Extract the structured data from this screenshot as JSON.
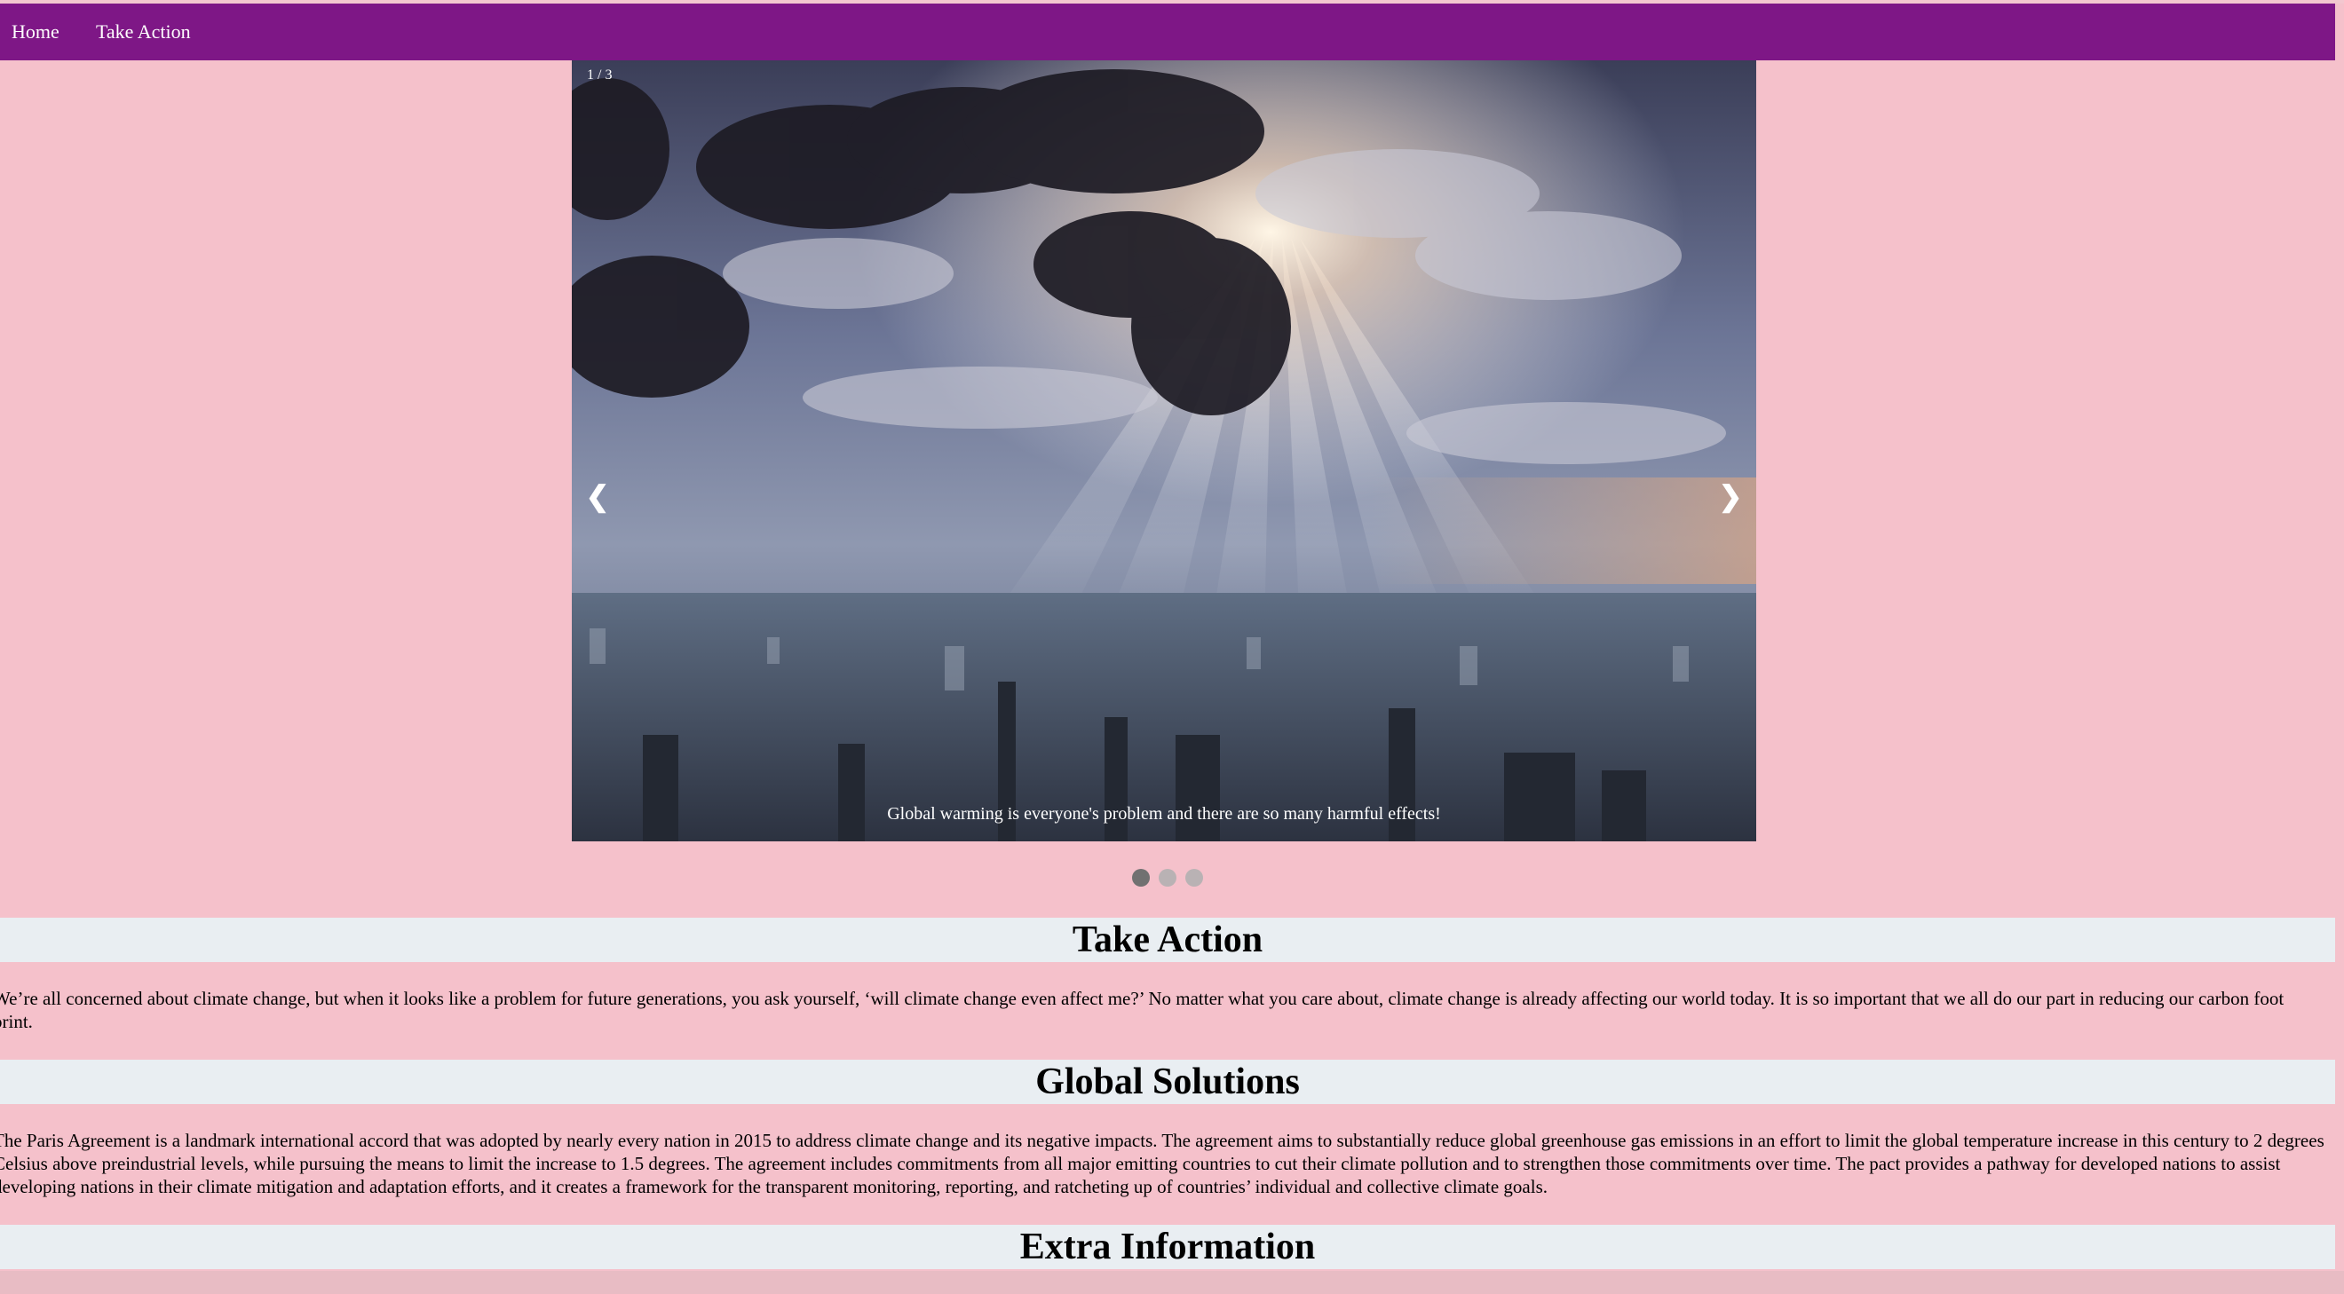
{
  "nav": {
    "home_label": "Home",
    "take_action_label": "Take Action"
  },
  "slideshow": {
    "counter": "1 / 3",
    "prev_icon": "chevron-left-icon",
    "next_icon": "chevron-right-icon",
    "prev_glyph": "❮",
    "next_glyph": "❯",
    "caption": "Global warming is everyone's problem and there are so many harmful effects!",
    "current_slide": 1,
    "total_slides": 3
  },
  "sections": [
    {
      "heading": "Take Action",
      "text": "We’re all concerned about climate change, but when it looks like a problem for future generations, you ask yourself, ‘will climate change even affect me?’ No matter what you care about, climate change is already affecting our world today. It is so important that we all do our part in reducing our carbon foot print."
    },
    {
      "heading": "Global Solutions",
      "text": "The Paris Agreement is a landmark international accord that was adopted by nearly every nation in 2015 to address climate change and its negative impacts. The agreement aims to substantially reduce global greenhouse gas emissions in an effort to limit the global temperature increase in this century to 2 degrees Celsius above preindustrial levels, while pursuing the means to limit the increase to 1.5 degrees. The agreement includes commitments from all major emitting countries to cut their climate pollution and to strengthen those commitments over time. The pact provides a pathway for developed nations to assist developing nations in their climate mitigation and adaptation efforts, and it creates a framework for the transparent monitoring, reporting, and ratcheting up of countries’ individual and collective climate goals."
    },
    {
      "heading": "Extra Information"
    }
  ],
  "colors": {
    "page_background": "#f5c1cb",
    "navbar": "#7e1786",
    "heading_band": "#e9eef2",
    "dot_active": "#717171",
    "dot_inactive": "#b9b2b4"
  }
}
